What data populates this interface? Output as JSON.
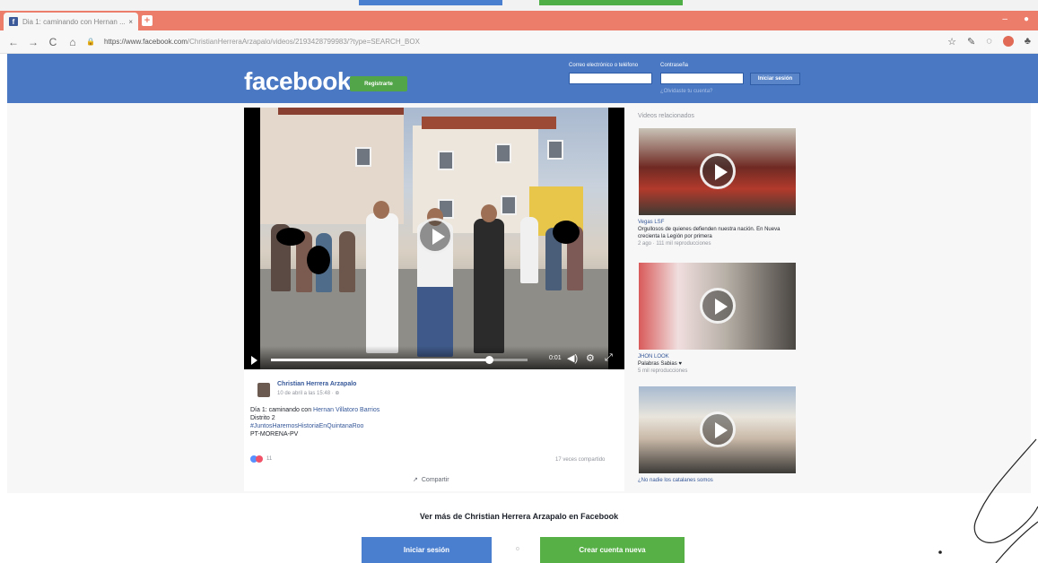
{
  "browser": {
    "tab_title": "Dia 1: caminando con Hernan ...",
    "tab_close": "×",
    "new_tab": "+",
    "url_host": "https://www.facebook.com",
    "url_path": "/ChristianHerreraArzapalo/videos/2193428799983/?type=SEARCH_BOX",
    "icons": [
      "back-icon",
      "forward-icon",
      "reload-icon",
      "home-icon",
      "lock-icon",
      "star-icon",
      "extension-icon"
    ]
  },
  "header": {
    "logo": "facebook",
    "register_label": "Registrarte",
    "email_label": "Correo electrónico o teléfono",
    "password_label": "Contraseña",
    "login_button": "Iniciar sesión",
    "forgot_link": "¿Olvidaste tu cuenta?"
  },
  "video": {
    "time": "0:01",
    "progress": 0.85
  },
  "post": {
    "author": "Christian Herrera Arzapalo",
    "time": "10 de abril a las 15:48 · ⊕",
    "line1_prefix": "Día 1: caminando con ",
    "line1_link": "Hernan Villatoro Barrios",
    "line2": "Distrito 2",
    "line3": "#JuntosHaremosHistoriaEnQuintanaRoo",
    "line4": "PT-MORENA-PV",
    "reaction_count": "11",
    "shares": "17 veces compartido",
    "share_label": "Compartir"
  },
  "related": {
    "title": "Videos relacionados",
    "items": [
      {
        "channel": "Vegas LSF",
        "text": "Orgullosos de quienes defienden nuestra nación. En Nueva crecienta la Legión por primera",
        "sub": "2 ago · 111 mil reproducciones"
      },
      {
        "channel": "JHON LOOK",
        "text": "Palabras Sabias ♥",
        "sub": "5 mil reproducciones"
      },
      {
        "channel": "",
        "text": "¿No nadie los catalanes somos",
        "sub": ""
      }
    ]
  },
  "footer": {
    "see_more": "Ver más de Christian Herrera Arzapalo en Facebook",
    "login_label": "Iniciar sesión",
    "or_label": "o",
    "create_label": "Crear cuenta nueva"
  },
  "colors": {
    "facebook_blue": "#4a78c2",
    "tab_bar": "#ec7d6a",
    "create_green": "#56b046",
    "login_blue": "#4a7fd0"
  }
}
